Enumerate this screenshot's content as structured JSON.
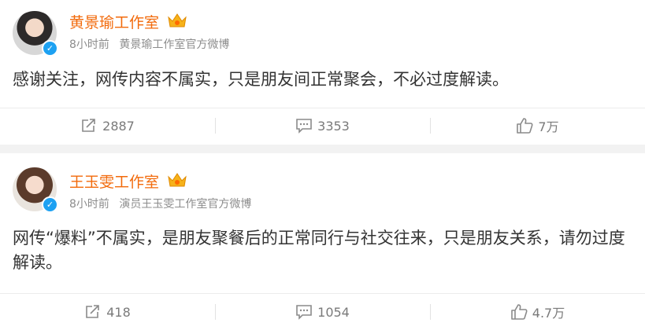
{
  "posts": [
    {
      "author": "黄景瑜工作室",
      "time": "8小时前",
      "source": "黄景瑜工作室官方微博",
      "text": "感谢关注，网传内容不属实，只是朋友间正常聚会，不必过度解读。",
      "reposts": "2887",
      "comments": "3353",
      "likes": "7万"
    },
    {
      "author": "王玉雯工作室",
      "time": "8小时前",
      "source": "演员王玉雯工作室官方微博",
      "text": "网传“爆料”不属实，是朋友聚餐后的正常同行与社交往来，只是朋友关系，请勿过度解读。",
      "reposts": "418",
      "comments": "1054",
      "likes": "4.7万"
    }
  ],
  "icons": {
    "verified": "verified-badge-icon",
    "crown": "crown-icon",
    "repost": "repost-icon",
    "comment": "comment-icon",
    "like": "like-icon"
  },
  "colors": {
    "author": "#f26a0b",
    "verified": "#1da1f2"
  }
}
